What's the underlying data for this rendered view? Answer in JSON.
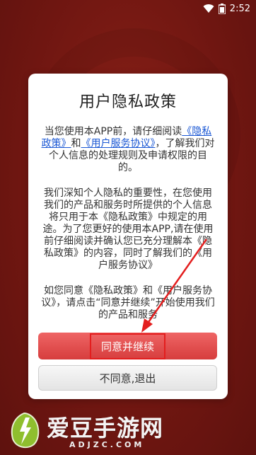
{
  "status_bar": {
    "time": "2:52"
  },
  "dialog": {
    "title": "用户隐私政策",
    "para1_a": "当您使用本APP前，请仔细阅读",
    "link_privacy": "《隐私政策》",
    "para1_and": "和",
    "link_terms": "《用户服务协议》",
    "para1_b": "，了解我们对个人信息的处理规则及申请权限的目的。",
    "para2": "我们深知个人隐私的重要性，在您使用我们的产品和服务时所提供的个人信息将只用于本《隐私政策》中规定的用途。为了您更好的使用本APP,请在使用前仔细阅读并确认您已充分理解本《隐私政策》的内容，同时了解我们的《用户服务协议》",
    "para3": "如您同意《隐私政策》和《用户服务协议》，请点击“同意并继续”开始使用我们的产品和服务",
    "agree_label": "同意并继续",
    "disagree_label": "不同意,退出"
  },
  "watermark": {
    "name": "爱豆手游网",
    "url": "ADJZC.COM"
  },
  "colors": {
    "background": "#7a1a14",
    "link": "#1a57d4",
    "agree_button": "#e05050",
    "highlight": "#e31e1e"
  }
}
